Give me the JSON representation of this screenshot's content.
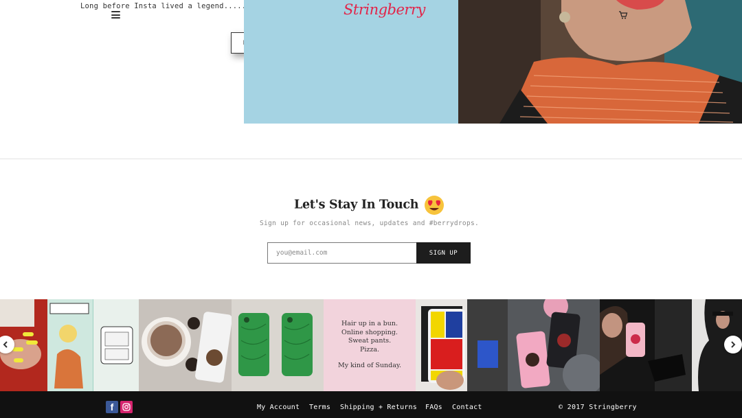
{
  "promo": {
    "text": "Long before Insta lived a legend...................",
    "read_more": "READ MORE"
  },
  "brand": {
    "logo": "Stringberry",
    "color": "#e22449"
  },
  "icons": {
    "menu": "hamburger-menu-icon",
    "cart": "shopping-cart-icon",
    "prev": "chevron-left-icon",
    "next": "chevron-right-icon"
  },
  "newsletter": {
    "title": "Let's Stay In Touch",
    "emoji": "heart-eyes-emoji",
    "subtitle": "Sign up for occasional news, updates and #berrydrops.",
    "email_placeholder": "you@email.com",
    "signup_label": "SIGN UP"
  },
  "gallery": {
    "quote_lines": [
      "Hair up in a bun.",
      "Online shopping.",
      "Sweat pants.",
      "Pizza.",
      "My kind of Sunday."
    ]
  },
  "footer": {
    "social": [
      "facebook-icon",
      "instagram-icon"
    ],
    "links": [
      "My Account",
      "Terms",
      "Shipping + Returns",
      "FAQs",
      "Contact"
    ],
    "copyright": "© 2017 Stringberry"
  }
}
